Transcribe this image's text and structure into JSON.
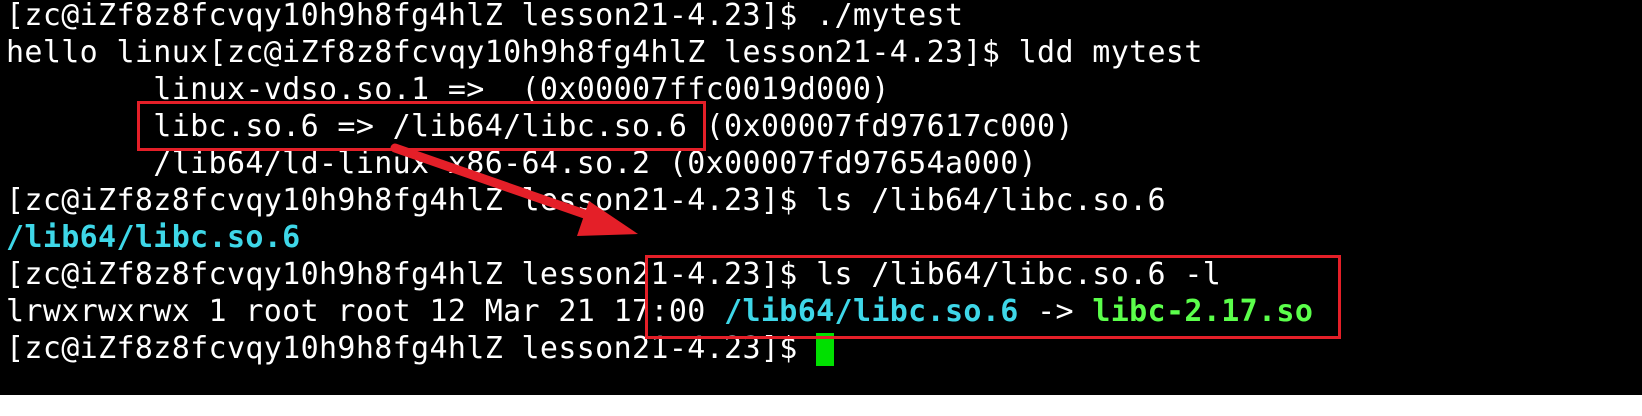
{
  "terminal": {
    "colors": {
      "background": "#000000",
      "text": "#ffffff",
      "symlink_path": "#3ed7e8",
      "library_target": "#5bff4b",
      "cursor": "#00e000",
      "annotation": "#e41f28"
    },
    "lines": [
      {
        "prompt": "[zc@iZf8z8fcvqy10h9h8fg4hlZ lesson21-4.23]$ ",
        "command": "./mytest"
      },
      {
        "output": "hello linux",
        "prompt": "[zc@iZf8z8fcvqy10h9h8fg4hlZ lesson21-4.23]$ ",
        "command": "ldd mytest"
      },
      {
        "text": "        linux-vdso.so.1 =>  (0x00007ffc0019d000)"
      },
      {
        "text": "        libc.so.6 => /lib64/libc.so.6 (0x00007fd97617c000)"
      },
      {
        "text": "        /lib64/ld-linux-x86-64.so.2 (0x00007fd97654a000)"
      },
      {
        "prompt": "[zc@iZf8z8fcvqy10h9h8fg4hlZ lesson21-4.23]$ ",
        "command": "ls /lib64/libc.so.6"
      },
      {
        "path": "/lib64/libc.so.6"
      },
      {
        "prompt": "[zc@iZf8z8fcvqy10h9h8fg4hlZ lesson21-4.23]$ ",
        "command": "ls /lib64/libc.so.6 -l"
      },
      {
        "prefix": "lrwxrwxrwx 1 root root 12 Mar 21 17:00 ",
        "path": "/lib64/libc.so.6",
        "arrow": " -> ",
        "target": "libc-2.17.so"
      },
      {
        "prompt": "[zc@iZf8z8fcvqy10h9h8fg4hlZ lesson21-4.23]$ ",
        "cursor": "block"
      }
    ]
  }
}
